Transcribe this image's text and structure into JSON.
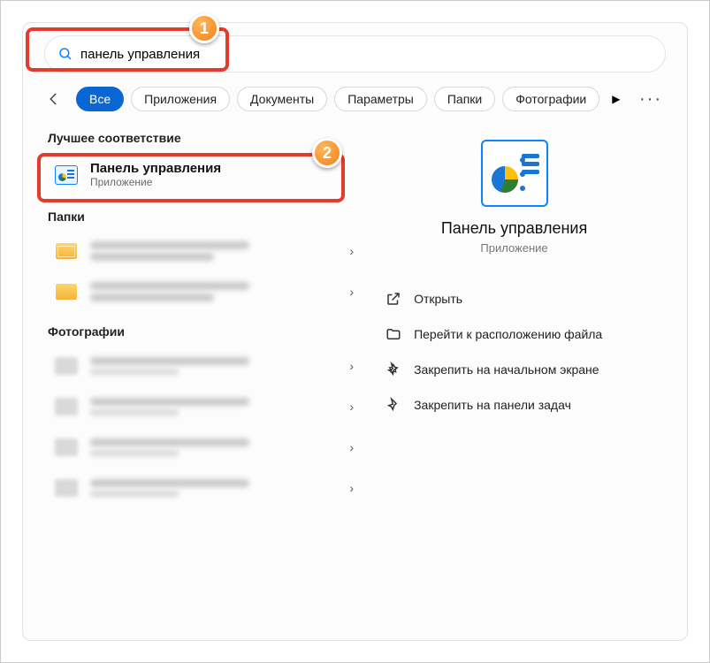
{
  "search": {
    "query": "панель управления"
  },
  "filters": {
    "all": "Все",
    "apps": "Приложения",
    "docs": "Документы",
    "settings": "Параметры",
    "folders": "Папки",
    "photos": "Фотографии"
  },
  "left": {
    "best_match_header": "Лучшее соответствие",
    "best_match": {
      "title": "Панель управления",
      "subtitle": "Приложение"
    },
    "folders_header": "Папки",
    "photos_header": "Фотографии"
  },
  "preview": {
    "title": "Панель управления",
    "subtitle": "Приложение",
    "actions": {
      "open": "Открыть",
      "goto_location": "Перейти к расположению файла",
      "pin_start": "Закрепить на начальном экране",
      "pin_taskbar": "Закрепить на панели задач"
    }
  },
  "annotations": {
    "step1": "1",
    "step2": "2"
  }
}
